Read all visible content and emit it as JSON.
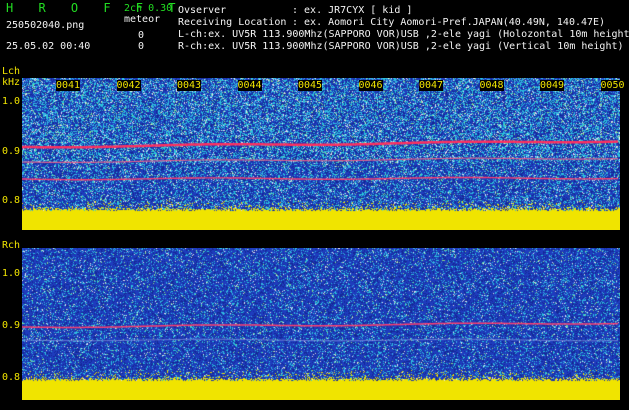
{
  "app": {
    "title": "H R O F F T",
    "mode": "2ch 0.30",
    "filename": "250502040.png",
    "meteor_label": "meteor",
    "datetime": "25.05.02 00:40",
    "count_l": "0",
    "count_r": "0"
  },
  "info": {
    "observer_label": "Ovserver",
    "observer_value": ": ex. JR7CYX [ kid ]",
    "location_label": "Receiving Location",
    "location_value": ": ex. Aomori City Aomori-Pref.JAPAN(40.49N, 140.47E)",
    "lch_line": "L-ch:ex. UV5R 113.900Mhz(SAPPORO VOR)USB ,2-ele yagi (Holozontal 10m height)",
    "rch_line": "R-ch:ex. UV5R 113.900Mhz(SAPPORO VOR)USB ,2-ele yagi (Vertical 10m height)"
  },
  "lch": {
    "label": "Lch",
    "unit": "kHz",
    "time_ticks": [
      "0041",
      "0042",
      "0043",
      "0044",
      "0045",
      "0046",
      "0047",
      "0048",
      "0049",
      "0050"
    ],
    "freq_ticks": [
      "1.0",
      "0.9",
      "0.8"
    ]
  },
  "rch": {
    "label": "Rch",
    "freq_ticks": [
      "1.0",
      "0.9",
      "0.8"
    ]
  },
  "colors": {
    "background": "#000000",
    "noise_base": "#1a2fa0",
    "signal": "#ff3060",
    "noise_floor": "#f0e400",
    "header_green": "#22dd22"
  }
}
